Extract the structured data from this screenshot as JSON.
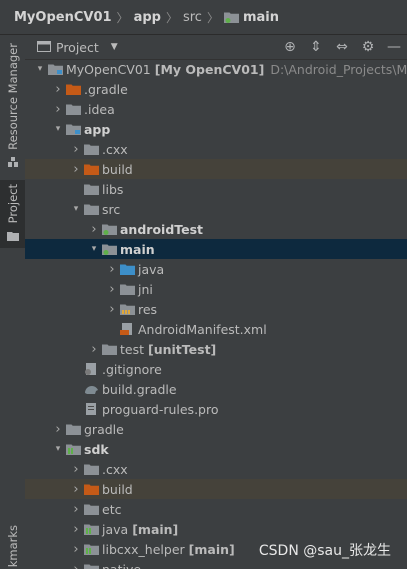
{
  "breadcrumb": [
    {
      "label": "MyOpenCV01",
      "icon": "none",
      "bold": true
    },
    {
      "label": "app",
      "icon": "none",
      "bold": true
    },
    {
      "label": "src",
      "icon": "none",
      "bold": false
    },
    {
      "label": "main",
      "icon": "folder-icon",
      "bold": true
    }
  ],
  "side_tabs": {
    "resource_manager": "Resource Manager",
    "project": "Project",
    "bookmarks": "kmarks"
  },
  "panel": {
    "title": "Project"
  },
  "toolbar_icons": [
    "locate-icon",
    "expand-all-icon",
    "collapse-all-icon",
    "gear-icon",
    "hide-icon"
  ],
  "tree": [
    {
      "label": "MyOpenCV01",
      "bold": false,
      "extra_bold": "[My OpenCV01]",
      "extra": "D:\\Android_Projects\\MyC",
      "depth": 0,
      "expanded": true,
      "icon": "module-folder-icon",
      "state": ""
    },
    {
      "label": ".gradle",
      "depth": 1,
      "expanded": false,
      "icon": "folder-orange-icon",
      "state": ""
    },
    {
      "label": ".idea",
      "depth": 1,
      "expanded": false,
      "icon": "folder-icon",
      "state": ""
    },
    {
      "label": "app",
      "bold": true,
      "depth": 1,
      "expanded": true,
      "icon": "module-folder-icon",
      "state": ""
    },
    {
      "label": ".cxx",
      "depth": 2,
      "expanded": false,
      "icon": "folder-icon",
      "state": ""
    },
    {
      "label": "build",
      "depth": 2,
      "expanded": false,
      "icon": "folder-orange-icon",
      "state": "hl"
    },
    {
      "label": "libs",
      "depth": 2,
      "expanded": null,
      "icon": "folder-icon",
      "state": ""
    },
    {
      "label": "src",
      "depth": 2,
      "expanded": true,
      "icon": "folder-icon",
      "state": ""
    },
    {
      "label": "androidTest",
      "bold": true,
      "depth": 3,
      "expanded": false,
      "icon": "test-folder-icon",
      "state": ""
    },
    {
      "label": "main",
      "bold": true,
      "depth": 3,
      "expanded": true,
      "icon": "source-folder-icon",
      "state": "sel"
    },
    {
      "label": "java",
      "depth": 4,
      "expanded": false,
      "icon": "folder-blue-icon",
      "state": ""
    },
    {
      "label": "jni",
      "depth": 4,
      "expanded": false,
      "icon": "folder-icon",
      "state": ""
    },
    {
      "label": "res",
      "depth": 4,
      "expanded": false,
      "icon": "resource-folder-icon",
      "state": ""
    },
    {
      "label": "AndroidManifest.xml",
      "depth": 4,
      "expanded": null,
      "icon": "manifest-file-icon",
      "state": ""
    },
    {
      "label": "test",
      "extra_bold": "[unitTest]",
      "depth": 3,
      "expanded": false,
      "icon": "folder-icon",
      "state": ""
    },
    {
      "label": ".gitignore",
      "depth": 2,
      "expanded": null,
      "icon": "gitignore-file-icon",
      "state": ""
    },
    {
      "label": "build.gradle",
      "depth": 2,
      "expanded": null,
      "icon": "gradle-file-icon",
      "state": ""
    },
    {
      "label": "proguard-rules.pro",
      "depth": 2,
      "expanded": null,
      "icon": "text-file-icon",
      "state": ""
    },
    {
      "label": "gradle",
      "depth": 1,
      "expanded": false,
      "icon": "folder-icon",
      "state": ""
    },
    {
      "label": "sdk",
      "bold": true,
      "depth": 1,
      "expanded": true,
      "icon": "library-module-icon",
      "state": ""
    },
    {
      "label": ".cxx",
      "depth": 2,
      "expanded": false,
      "icon": "folder-icon",
      "state": ""
    },
    {
      "label": "build",
      "depth": 2,
      "expanded": false,
      "icon": "folder-orange-icon",
      "state": "hl"
    },
    {
      "label": "etc",
      "depth": 2,
      "expanded": false,
      "icon": "folder-icon",
      "state": ""
    },
    {
      "label": "java",
      "extra_bold": "[main]",
      "depth": 2,
      "expanded": false,
      "icon": "library-folder-icon",
      "state": ""
    },
    {
      "label": "libcxx_helper",
      "extra_bold": "[main]",
      "depth": 2,
      "expanded": false,
      "icon": "library-folder-icon",
      "state": ""
    },
    {
      "label": "native",
      "depth": 2,
      "expanded": false,
      "icon": "folder-icon",
      "state": ""
    }
  ],
  "watermark": "CSDN @sau_张龙生",
  "colors": {
    "background": "#2b2b2b",
    "panel": "#3c3f41",
    "selection": "#0d293e",
    "excluded_highlight": "#45423a",
    "folder": "#8c9196",
    "excluded_folder": "#c55a17",
    "source_folder": "#3d8fc9"
  }
}
